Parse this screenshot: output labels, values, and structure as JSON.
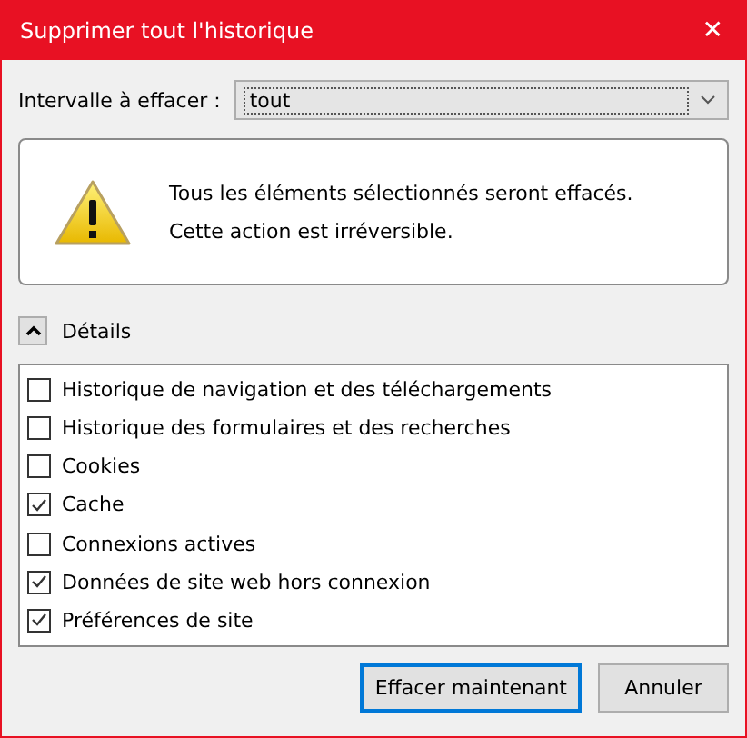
{
  "window": {
    "title": "Supprimer tout l'historique",
    "close": "✕"
  },
  "range": {
    "label": "Intervalle à effacer :",
    "value": "tout"
  },
  "warning": {
    "lines": [
      "Tous les éléments sélectionnés seront effacés.",
      "Cette action est irréversible."
    ]
  },
  "details": {
    "label": "Détails",
    "expanded": true
  },
  "items": [
    {
      "label": "Historique de navigation et des téléchargements",
      "checked": false
    },
    {
      "label": "Historique des formulaires et des recherches",
      "checked": false
    },
    {
      "label": "Cookies",
      "checked": false
    },
    {
      "label": "Cache",
      "checked": true
    },
    {
      "label": "Connexions actives",
      "checked": false
    },
    {
      "label": "Données de site web hors connexion",
      "checked": true
    },
    {
      "label": "Préférences de site",
      "checked": true
    }
  ],
  "buttons": [
    {
      "label": "Effacer maintenant",
      "default": true
    },
    {
      "label": "Annuler",
      "default": false
    }
  ]
}
